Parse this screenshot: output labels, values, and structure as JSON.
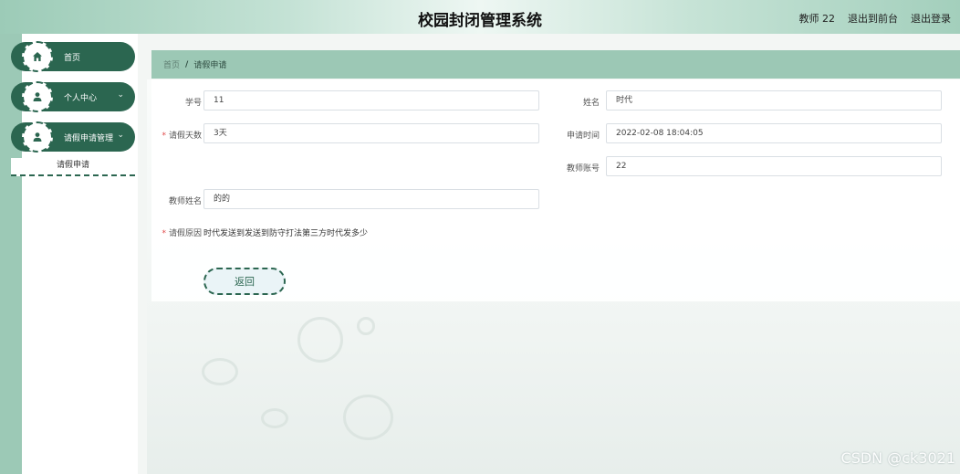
{
  "header": {
    "title": "校园封闭管理系统",
    "user_label": "教师 22",
    "front_link": "退出到前台",
    "logout_link": "退出登录"
  },
  "sidebar": {
    "items": [
      {
        "label": "首页",
        "icon": "home-icon",
        "expandable": false
      },
      {
        "label": "个人中心",
        "icon": "user-icon",
        "expandable": true,
        "chevron": "chevron-down-icon"
      },
      {
        "label": "请假申请管理",
        "icon": "user-icon",
        "expandable": true,
        "chevron": "chevron-down-icon"
      }
    ],
    "subitem": "请假申请"
  },
  "breadcrumb": {
    "home": "首页",
    "separator": "/",
    "current": "请假申请"
  },
  "form": {
    "student_id": {
      "label": "学号",
      "value": "11"
    },
    "name": {
      "label": "姓名",
      "value": "时代"
    },
    "leave_days": {
      "label": "请假天数",
      "value": "3天",
      "required": true
    },
    "apply_time": {
      "label": "申请时间",
      "value": "2022-02-08 18:04:05"
    },
    "teacher_account": {
      "label": "教师账号",
      "value": "22"
    },
    "teacher_name": {
      "label": "教师姓名",
      "value": "的的"
    },
    "reason": {
      "label": "请假原因",
      "value": "时代发送到发送到防守打法第三方时代发多少",
      "required": true
    },
    "back_button": "返回"
  },
  "watermark": "CSDN @ck3021",
  "colors": {
    "primary": "#2b6650",
    "accent": "#9cc8b5",
    "required": "#e04848"
  }
}
